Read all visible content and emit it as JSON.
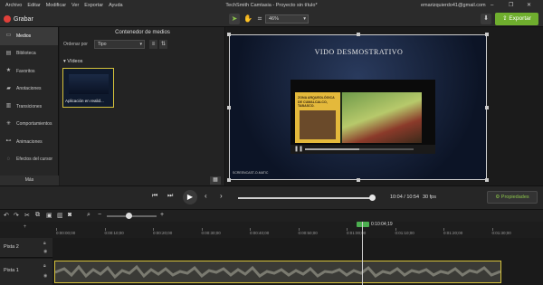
{
  "titlebar": {
    "menu": [
      "Archivo",
      "Editar",
      "Modificar",
      "Ver",
      "Exportar",
      "Ayuda"
    ],
    "title": "TechSmith Camtasia - Proyecto sin título*",
    "account": "emarizquierdo41@gmail.com"
  },
  "toolbar": {
    "record_label": "Grabar",
    "zoom": "46%",
    "export_label": "Exportar"
  },
  "nav": {
    "items": [
      {
        "label": "Medios",
        "icon": "film-icon",
        "active": true
      },
      {
        "label": "Biblioteca",
        "icon": "library-icon",
        "active": false
      },
      {
        "label": "Favoritos",
        "icon": "star-icon",
        "active": false
      },
      {
        "label": "Anotaciones",
        "icon": "annotation-icon",
        "active": false
      },
      {
        "label": "Transiciones",
        "icon": "transition-icon",
        "active": false
      },
      {
        "label": "Comportamientos",
        "icon": "behavior-icon",
        "active": false
      },
      {
        "label": "Animaciones",
        "icon": "animation-icon",
        "active": false
      },
      {
        "label": "Efectos del cursor",
        "icon": "cursor-effect-icon",
        "active": false
      }
    ],
    "more_label": "Más"
  },
  "bin": {
    "title": "Contenedor de medios",
    "sort_label": "Ordenar por",
    "sort_value": "Tipo",
    "section_label": "Vídeos",
    "clip_label": "Aplicación en realid..."
  },
  "canvas": {
    "slide_title": "VIDO DESMOSTRATIVO",
    "inner_title": "ZONA ARQUEOLÓGICA DE CUMALCALCO, TABASCO.",
    "footer_small": "SCREENCAST-O-MATIC"
  },
  "playback": {
    "time": "10:04 / 10:54",
    "fps": "30 fps",
    "properties_label": "Propiedades"
  },
  "timeline": {
    "playhead_time": "0:10:04;19",
    "ticks": [
      "0:00:00;00",
      "0:00:10;00",
      "0:00:20;00",
      "0:00:30;00",
      "0:00:40;00",
      "0:00:50;00",
      "0:01:00;00",
      "0:01:10;00",
      "0:01:20;00",
      "0:01:30;00"
    ],
    "tracks": [
      "Pista 2",
      "Pista 1"
    ]
  },
  "colors": {
    "accent_green": "#8bc34a",
    "record_red": "#e0403a",
    "clip_outline": "#d6c23a"
  }
}
